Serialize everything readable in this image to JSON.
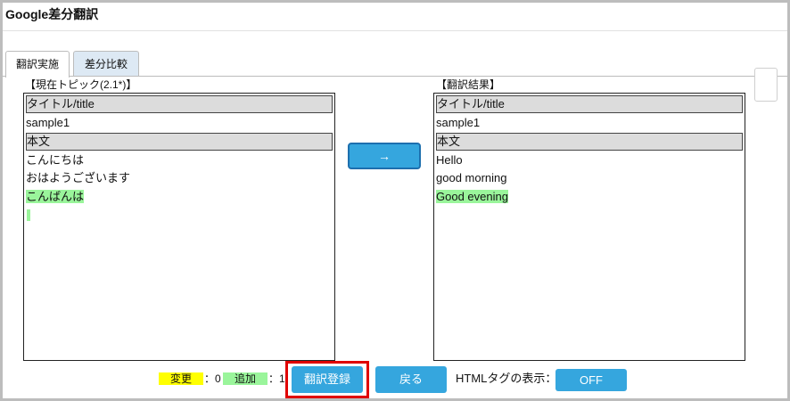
{
  "app": {
    "title": "Google差分翻訳"
  },
  "tabs": [
    {
      "label": "翻訳実施",
      "active": true
    },
    {
      "label": "差分比較",
      "active": false
    }
  ],
  "left_panel": {
    "label": "【現在トピック(2.1*)】",
    "lines": [
      {
        "text": "タイトル/title",
        "type": "header"
      },
      {
        "text": "sample1",
        "type": "normal"
      },
      {
        "text": "本文",
        "type": "header"
      },
      {
        "text": "こんにちは",
        "type": "normal"
      },
      {
        "text": "おはようございます",
        "type": "normal"
      },
      {
        "text": "こんばんは",
        "type": "added"
      },
      {
        "text": "",
        "type": "added-empty"
      }
    ]
  },
  "right_panel": {
    "label": "【翻訳結果】",
    "lines": [
      {
        "text": "タイトル/title",
        "type": "header"
      },
      {
        "text": "sample1",
        "type": "normal"
      },
      {
        "text": "本文",
        "type": "header"
      },
      {
        "text": "Hello",
        "type": "normal"
      },
      {
        "text": "good morning",
        "type": "normal"
      },
      {
        "text": "Good evening",
        "type": "added"
      }
    ]
  },
  "translate_arrow": {
    "label": "→"
  },
  "legend": {
    "changed_label": "変更",
    "changed_count": "：0",
    "added_label": "追加",
    "added_count": "：1",
    "changed_color": "#ffff00",
    "added_color": "#9af59b"
  },
  "buttons": {
    "register": "翻訳登録",
    "back": "戻る",
    "html_tag_label": "HTMLタグの表示：",
    "html_tag_toggle": "OFF"
  },
  "colors": {
    "button": "#35a6de",
    "highlight_border": "#e00000",
    "header_row": "#dcdcdc",
    "inactive_tab": "#dde9f4"
  }
}
